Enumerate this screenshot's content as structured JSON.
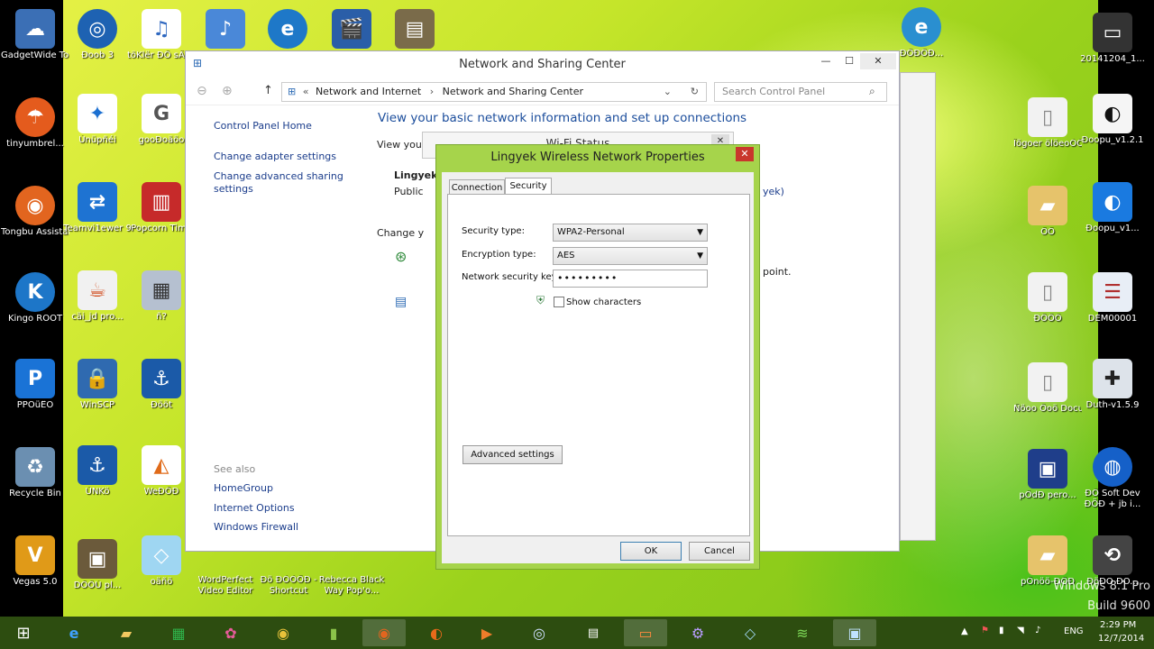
{
  "desktop": {
    "left_icons": [
      {
        "label": "GadgetWide Tool",
        "icon": "gadget-cloud-icon",
        "color": "#3b6fb5"
      },
      {
        "label": "tinyumbrel...",
        "icon": "umbrella-icon",
        "color": "#e45b1d"
      },
      {
        "label": "Tongbu Assistant",
        "icon": "tongbu-icon",
        "color": "#e2651f"
      },
      {
        "label": "Kingo ROOT",
        "icon": "kingo-root-icon",
        "color": "#1d76c8"
      },
      {
        "label": "PPÖüÊÖ",
        "icon": "pp-icon",
        "color": "#1a73d6"
      },
      {
        "label": "Recycle Bin",
        "icon": "recycle-bin-icon",
        "color": "#6b8fb1"
      },
      {
        "label": "Vegas 5.0",
        "icon": "vegas-icon",
        "color": "#e09a18"
      }
    ],
    "col2_icons": [
      {
        "label": "Ðoob 3",
        "icon": "app-icon",
        "color": "#1e62b2"
      },
      {
        "label": "Ùnüpñéi",
        "icon": "runner-icon",
        "color": "#1b6fd1"
      },
      {
        "label": "Teamvi1ewer 9",
        "icon": "teamviewer-icon",
        "color": "#1e73d2"
      },
      {
        "label": "cäi_jd pro...",
        "icon": "java-icon",
        "color": "#f1f1f1"
      },
      {
        "label": "WinSCP",
        "icon": "winscp-icon",
        "color": "#2f6ab0"
      },
      {
        "label": "ÙNKö",
        "icon": "anchor-icon",
        "color": "#1b5aa8"
      },
      {
        "label": "DÕÖÙ pl...",
        "icon": "video-thumb-icon",
        "color": "#6b5a3b"
      }
    ],
    "col3_icons": [
      {
        "label": "töKlër ÐÕ sÄëräñ",
        "icon": "mp3-icon",
        "color": "#2f68c0"
      },
      {
        "label": "gooÐoäöo",
        "icon": "google-icon",
        "color": "#ffffff"
      },
      {
        "label": "Popcorn Time",
        "icon": "popcorn-icon",
        "color": "#c62a2a"
      },
      {
        "label": "ñ?",
        "icon": "thumbnail-icon",
        "color": "#b5c0d0"
      },
      {
        "label": "Ðööt",
        "icon": "anchor-icon",
        "color": "#1b5aa8"
      },
      {
        "label": "WeÐÕÐ",
        "icon": "ms-icon",
        "color": "#ffffff"
      },
      {
        "label": "oäñö",
        "icon": "glass-icon",
        "color": "#9fd6f2"
      }
    ],
    "bottom_icons": [
      {
        "label": "WordPerfect Video Editor",
        "icon": "shortcut-icon"
      },
      {
        "label": "Ðö ÐÓÓÖÐ - Shortcut",
        "icon": "drive-icon"
      },
      {
        "label": "Rebecca Black Way Pop'o...",
        "icon": "mp3-icon"
      }
    ],
    "top_icons": [
      {
        "label": "",
        "icon": "music-file-icon"
      },
      {
        "label": "",
        "icon": "video-icon"
      },
      {
        "label": "",
        "icon": "photo-icon"
      }
    ],
    "right_col_a": [
      {
        "label": "ÐÖÐÖÐ...",
        "icon": "ie-icon"
      },
      {
        "label": "Ïögoer ölöeoÓÖÐ...",
        "icon": "file-icon"
      },
      {
        "label": "ÖÖ",
        "icon": "folder-icon"
      },
      {
        "label": "ÐÖÖÖ",
        "icon": "file-icon"
      },
      {
        "label": "Ñöoo Öoö Document",
        "icon": "file-icon"
      },
      {
        "label": "pÖdÐ pero...",
        "icon": "vm-icon"
      },
      {
        "label": "pÖnöö-ÐÖÐ",
        "icon": "folder-icon"
      }
    ],
    "right_col_b": [
      {
        "label": "20141204_1...",
        "icon": "phone-icon"
      },
      {
        "label": "Ðoopu_v1.2.1",
        "icon": "apple-icon"
      },
      {
        "label": "Ðoopu_v1...",
        "icon": "apple-blue-icon"
      },
      {
        "label": "DEM00001",
        "icon": "contact-icon"
      },
      {
        "label": "Duth-v1.5.9",
        "icon": "ninja-icon"
      },
      {
        "label": "ÐÖ Soft Dev ÐÖÐ + jb i...",
        "icon": "globe-icon"
      },
      {
        "label": "ÐöÐÖ ÐÖ...",
        "icon": "backup-icon"
      }
    ],
    "watermark_line1": "Windows 8.1 Pro",
    "watermark_line2": "Build 9600"
  },
  "nsc_window": {
    "title": "Network and Sharing Center",
    "address_parts": [
      "Network and Internet",
      "Network and Sharing Center"
    ],
    "search_placeholder": "Search Control Panel",
    "heading": "View your basic network information and set up connections",
    "left_links": [
      "Control Panel Home",
      "Change adapter settings",
      "Change advanced sharing settings"
    ],
    "see_also_label": "See also",
    "see_also_links": [
      "HomeGroup",
      "Internet Options",
      "Windows Firewall"
    ],
    "partial_texts": [
      "View your",
      "Lingyek",
      "Public",
      "Change y",
      "yek)",
      "point."
    ]
  },
  "wifi_status_window": {
    "title": "Wi-Fi Status"
  },
  "dialog": {
    "title": "Lingyek Wireless Network Properties",
    "tabs": [
      "Connection",
      "Security"
    ],
    "active_tab": "Security",
    "security_type_label": "Security type:",
    "security_type_value": "WPA2-Personal",
    "encryption_type_label": "Encryption type:",
    "encryption_type_value": "AES",
    "network_key_label": "Network security key",
    "network_key_value": "•••••••••",
    "show_characters_label": "Show characters",
    "advanced_button": "Advanced settings",
    "ok_button": "OK",
    "cancel_button": "Cancel"
  },
  "taskbar": {
    "language": "ENG",
    "time": "2:29 PM",
    "date": "12/7/2014"
  }
}
